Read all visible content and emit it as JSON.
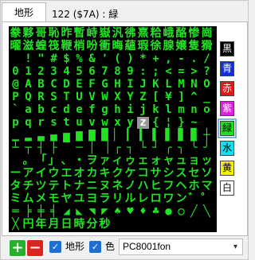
{
  "tab": {
    "label": "地形"
  },
  "info": {
    "text": "122 ($7A) : 緑"
  },
  "grid": {
    "rows": [
      [
        "豢",
        "夥",
        "哥",
        "恥",
        "昨",
        "暫",
        "峙",
        "嶽",
        "汎",
        "彿",
        "熹",
        "粭",
        "峨",
        "酪",
        "惨",
        "崗"
      ],
      [
        "曜",
        "滋",
        "蝗",
        "筏",
        "鞭",
        "梢",
        "吩",
        "衝",
        "晦",
        "蘊",
        "瑕",
        "徐",
        "腺",
        "嬢",
        "隻",
        "猾"
      ],
      [
        "",
        "!",
        "\"",
        "#",
        "$",
        "%",
        "&",
        "'",
        "(",
        ")",
        "*",
        "+",
        ",",
        "-",
        ".",
        "/"
      ],
      [
        "0",
        "1",
        "2",
        "3",
        "4",
        "5",
        "6",
        "7",
        "8",
        "9",
        ":",
        ";",
        "<",
        "=",
        ">",
        "?"
      ],
      [
        "@",
        "A",
        "B",
        "C",
        "D",
        "E",
        "F",
        "G",
        "H",
        "I",
        "J",
        "K",
        "L",
        "M",
        "N",
        "O"
      ],
      [
        "P",
        "Q",
        "R",
        "S",
        "T",
        "U",
        "V",
        "W",
        "X",
        "Y",
        "Z",
        "[",
        "¥",
        "]",
        "^",
        "_"
      ],
      [
        "`",
        "a",
        "b",
        "c",
        "d",
        "e",
        "f",
        "g",
        "h",
        "i",
        "j",
        "k",
        "l",
        "m",
        "n",
        "o"
      ],
      [
        "p",
        "q",
        "r",
        "s",
        "t",
        "u",
        "v",
        "w",
        "x",
        "y",
        "z",
        "{",
        "¦",
        "}",
        "~",
        ""
      ],
      [
        "▁",
        "▂",
        "▃",
        "▄",
        "▅",
        "▆",
        "▇",
        "█",
        "▏",
        "▎",
        "▍",
        "▌",
        "▋",
        "▊",
        "▉",
        "┼"
      ],
      [
        "┴",
        "┬",
        "┤",
        "├",
        "▔",
        "─",
        "│",
        "▕",
        "┌",
        "┐",
        "└",
        "┘",
        "╭",
        "╮",
        "╰",
        "╯"
      ],
      [
        "",
        "。",
        "「",
        "」",
        "、",
        "・",
        "ヲ",
        "ァ",
        "ィ",
        "ゥ",
        "ェ",
        "ォ",
        "ャ",
        "ュ",
        "ョ",
        "ッ"
      ],
      [
        "ー",
        "ア",
        "イ",
        "ウ",
        "エ",
        "オ",
        "カ",
        "キ",
        "ク",
        "ケ",
        "コ",
        "サ",
        "シ",
        "ス",
        "セ",
        "ソ"
      ],
      [
        "タ",
        "チ",
        "ツ",
        "テ",
        "ト",
        "ナ",
        "ニ",
        "ヌ",
        "ネ",
        "ノ",
        "ハ",
        "ヒ",
        "フ",
        "ヘ",
        "ホ",
        "マ"
      ],
      [
        "ミ",
        "ム",
        "メ",
        "モ",
        "ヤ",
        "ユ",
        "ヨ",
        "ラ",
        "リ",
        "ル",
        "レ",
        "ロ",
        "ワ",
        "ン",
        "゛",
        "゜"
      ],
      [
        "═",
        "╞",
        "╪",
        "╡",
        "◢",
        "◣",
        "◥",
        "◤",
        "♠",
        "♥",
        "♦",
        "♣",
        "●",
        "○",
        "╱",
        "╲"
      ],
      [
        "╳",
        "円",
        "年",
        "月",
        "日",
        "時",
        "分",
        "秒",
        "",
        "",
        "",
        "",
        "",
        "",
        "",
        ""
      ]
    ],
    "selected": {
      "row": 7,
      "col": 10
    }
  },
  "palette": [
    {
      "label": "黒",
      "bg": "#000000",
      "fg": "#ffffff"
    },
    {
      "label": "青",
      "bg": "#1030e0",
      "fg": "#ffffff"
    },
    {
      "label": "赤",
      "bg": "#e01818",
      "fg": "#ffffff"
    },
    {
      "label": "紫",
      "bg": "#e020e0",
      "fg": "#ffffff"
    },
    {
      "label": "緑",
      "bg": "#22dd22",
      "fg": "#000000",
      "active": true
    },
    {
      "label": "水",
      "bg": "#10e0f0",
      "fg": "#000000"
    },
    {
      "label": "黄",
      "bg": "#f0f000",
      "fg": "#000000"
    },
    {
      "label": "白",
      "bg": "#ffffff",
      "fg": "#000000"
    }
  ],
  "toolbar": {
    "add_label": "+",
    "remove_label": "−",
    "check1_label": "地形",
    "check2_label": "色",
    "font_value": "PC8001fon"
  },
  "colors": {
    "glyph": "#22e422",
    "grid_bg": "#000000"
  }
}
